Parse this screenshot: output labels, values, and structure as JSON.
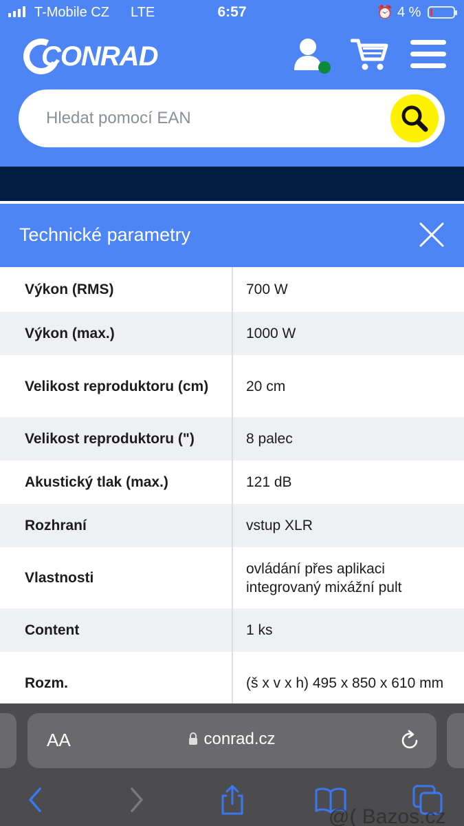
{
  "status_bar": {
    "carrier": "T-Mobile CZ",
    "network": "LTE",
    "time": "6:57",
    "battery": "4 %"
  },
  "header": {
    "logo": "CONRAD",
    "search_placeholder": "Hledat pomocí EAN"
  },
  "panel": {
    "title": "Technické parametry",
    "specs": [
      {
        "label": "Výkon (RMS)",
        "value": "700 W"
      },
      {
        "label": "Výkon (max.)",
        "value": "1000 W"
      },
      {
        "label": "Velikost reproduktoru (cm)",
        "value": "20 cm"
      },
      {
        "label": "Velikost reproduktoru (\")",
        "value": "8 palec"
      },
      {
        "label": "Akustický tlak (max.)",
        "value": "121 dB"
      },
      {
        "label": "Rozhraní",
        "value": "vstup XLR"
      },
      {
        "label": "Vlastnosti",
        "value": "ovládání přes aplikaci integrovaný mixážní pult"
      },
      {
        "label": "Content",
        "value": "1 ks"
      },
      {
        "label": "Rozm.",
        "value": "(š x v x h) 495 x 850 x 610 mm"
      }
    ]
  },
  "browser": {
    "text_size_label": "AA",
    "url": "conrad.cz",
    "toolbar": [
      "back-icon",
      "forward-icon",
      "share-icon",
      "bookmarks-icon",
      "tabs-icon"
    ]
  },
  "watermark": "@( Bazos.cz",
  "colors": {
    "brand_blue": "#4d85f5",
    "dark_navy": "#001e42",
    "search_yellow": "#fff200",
    "online_dot": "#0a8a3a",
    "toolbar_bg": "#4c4c4f",
    "toolbar_icon": "#3a78f2"
  }
}
